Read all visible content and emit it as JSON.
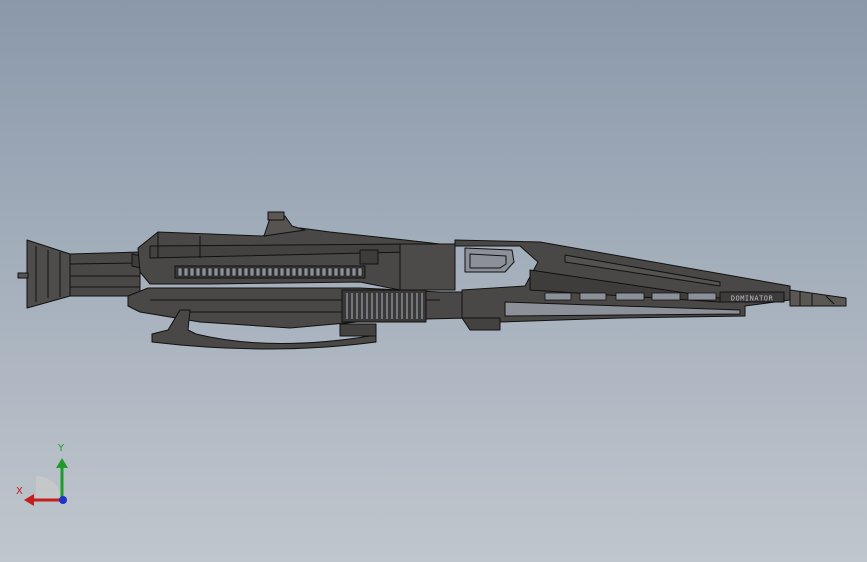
{
  "viewport": {
    "background_top": "#8a98aa",
    "background_bottom": "#c0c6cd"
  },
  "model": {
    "name_plate": "DOMINATOR",
    "body_color": "#4a4846",
    "edge_color": "#111111",
    "slot_color": "#8c9099"
  },
  "triad": {
    "x_label": "X",
    "y_label": "Y",
    "x_color": "#c41d1d",
    "y_color": "#1e9b2a",
    "z_color": "#1f33c7"
  }
}
